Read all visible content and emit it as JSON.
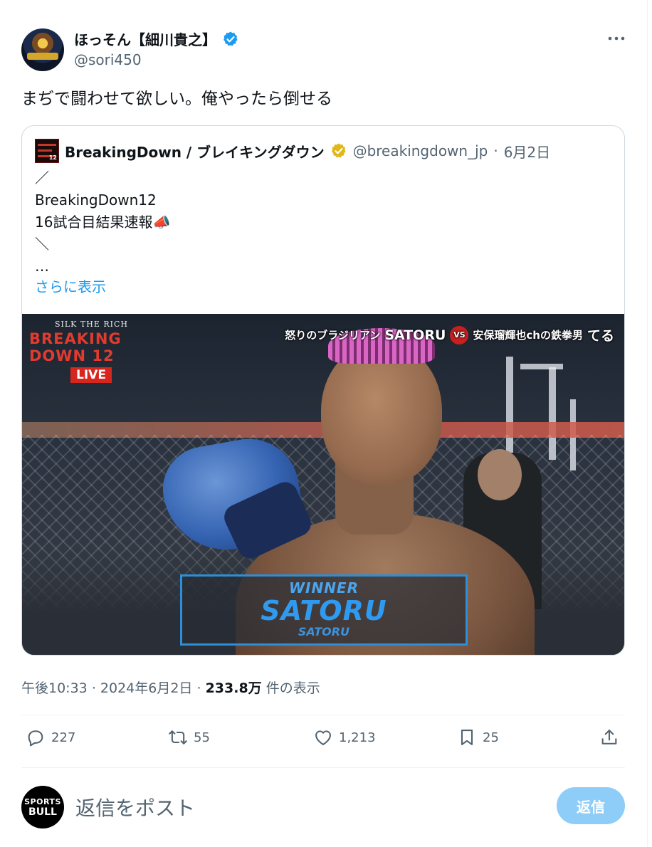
{
  "author": {
    "name": "ほっそん【細川貴之】",
    "handle": "@sori450",
    "verified_color": "#1d9bf0",
    "avatar_icon": "boxer-with-belt-avatar"
  },
  "tweet": {
    "text": "まぢで闘わせて欲しい。俺やったら倒せる"
  },
  "quote": {
    "name": "BreakingDown / ブレイキングダウン",
    "verified_color": "#e2b719",
    "handle": "@breakingdown_jp",
    "separator": "·",
    "date": "6月2日",
    "logo_number": "12",
    "lines": [
      "／",
      "BreakingDown12",
      "16試合目結果速報📣",
      "＼",
      "…"
    ],
    "show_more": "さらに表示",
    "media": {
      "brand_top": "SILK THE RICH",
      "brand_title": "BREAKING DOWN 12",
      "live": "LIVE",
      "left_fighter_title": "怒りのブラジリアン",
      "left_fighter": "SATORU",
      "vs": "VS",
      "right_fighter_title": "安保瑠輝也chの鉄拳男",
      "right_fighter": "てる",
      "winner_label": "WINNER",
      "winner_name": "SATORU",
      "winner_sub": "SATORU"
    }
  },
  "meta": {
    "time": "午後10:33",
    "dot": "·",
    "date": "2024年6月2日",
    "views": "233.8万",
    "views_label": "件の表示"
  },
  "actions": {
    "replies": "227",
    "reposts": "55",
    "likes": "1,213",
    "bookmarks": "25"
  },
  "reply_box": {
    "avatar_line1": "SPORTS",
    "avatar_line2": "BULL",
    "placeholder": "返信をポスト",
    "button": "返信",
    "button_color": "#8ecdf8"
  }
}
